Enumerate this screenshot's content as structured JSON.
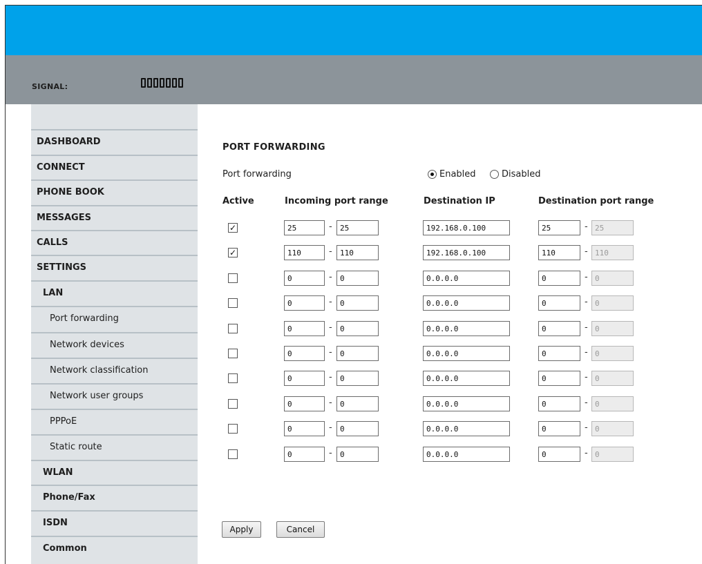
{
  "status": {
    "signal_label": "SIGNAL:",
    "signal_bars": 7
  },
  "sidebar": {
    "items": [
      {
        "label": "DASHBOARD",
        "level": 0
      },
      {
        "label": "CONNECT",
        "level": 0
      },
      {
        "label": "PHONE BOOK",
        "level": 0
      },
      {
        "label": "MESSAGES",
        "level": 0
      },
      {
        "label": "CALLS",
        "level": 0
      },
      {
        "label": "SETTINGS",
        "level": 0
      },
      {
        "label": "LAN",
        "level": 1
      },
      {
        "label": "Port forwarding",
        "level": 2
      },
      {
        "label": "Network devices",
        "level": 2
      },
      {
        "label": "Network classification",
        "level": 2
      },
      {
        "label": "Network user groups",
        "level": 2
      },
      {
        "label": "PPPoE",
        "level": 2
      },
      {
        "label": "Static route",
        "level": 2
      },
      {
        "label": "WLAN",
        "level": 1
      },
      {
        "label": "Phone/Fax",
        "level": 1
      },
      {
        "label": "ISDN",
        "level": 1
      },
      {
        "label": "Common",
        "level": 1
      }
    ]
  },
  "main": {
    "title": "PORT FORWARDING",
    "pf_label": "Port forwarding",
    "radio": {
      "enabled": "Enabled",
      "disabled": "Disabled",
      "selected": "enabled"
    },
    "columns": [
      "Active",
      "Incoming port range",
      "Destination IP",
      "Destination port range"
    ],
    "rows": [
      {
        "active": true,
        "in_from": "25",
        "in_to": "25",
        "dest_ip": "192.168.0.100",
        "dp_from": "25",
        "dp_to": "25"
      },
      {
        "active": true,
        "in_from": "110",
        "in_to": "110",
        "dest_ip": "192.168.0.100",
        "dp_from": "110",
        "dp_to": "110"
      },
      {
        "active": false,
        "in_from": "0",
        "in_to": "0",
        "dest_ip": "0.0.0.0",
        "dp_from": "0",
        "dp_to": "0"
      },
      {
        "active": false,
        "in_from": "0",
        "in_to": "0",
        "dest_ip": "0.0.0.0",
        "dp_from": "0",
        "dp_to": "0"
      },
      {
        "active": false,
        "in_from": "0",
        "in_to": "0",
        "dest_ip": "0.0.0.0",
        "dp_from": "0",
        "dp_to": "0"
      },
      {
        "active": false,
        "in_from": "0",
        "in_to": "0",
        "dest_ip": "0.0.0.0",
        "dp_from": "0",
        "dp_to": "0"
      },
      {
        "active": false,
        "in_from": "0",
        "in_to": "0",
        "dest_ip": "0.0.0.0",
        "dp_from": "0",
        "dp_to": "0"
      },
      {
        "active": false,
        "in_from": "0",
        "in_to": "0",
        "dest_ip": "0.0.0.0",
        "dp_from": "0",
        "dp_to": "0"
      },
      {
        "active": false,
        "in_from": "0",
        "in_to": "0",
        "dest_ip": "0.0.0.0",
        "dp_from": "0",
        "dp_to": "0"
      },
      {
        "active": false,
        "in_from": "0",
        "in_to": "0",
        "dest_ip": "0.0.0.0",
        "dp_from": "0",
        "dp_to": "0"
      }
    ],
    "apply_label": "Apply",
    "cancel_label": "Cancel"
  },
  "colors": {
    "topbar": "#00a2ea",
    "statusbar": "#8c949a",
    "sidebar": "#dfe3e6"
  }
}
